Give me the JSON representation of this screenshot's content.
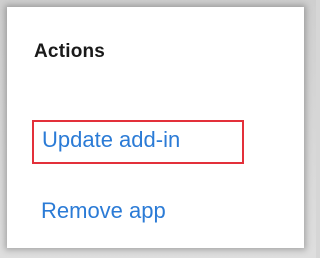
{
  "actions_panel": {
    "heading": "Actions",
    "update_link": "Update add-in",
    "remove_link": "Remove app",
    "highlight_color": "#e3303a",
    "link_color": "#2b7bd6"
  }
}
